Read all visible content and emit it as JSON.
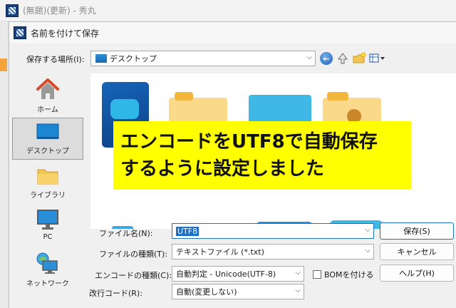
{
  "parent_window": {
    "title": "(無題)(更新) - 秀丸"
  },
  "dialog": {
    "title": "名前を付けて保存",
    "location": {
      "label": "保存する場所(I):",
      "value": "デスクトップ"
    },
    "toolbar": {
      "back_icon": "back-arrow-icon",
      "up_icon": "up-folder-icon",
      "new_folder_icon": "new-folder-icon",
      "view_icon": "view-menu-icon"
    },
    "sidebar": [
      {
        "label": "ホーム",
        "icon": "home-icon",
        "selected": false
      },
      {
        "label": "デスクトップ",
        "icon": "desktop-icon",
        "selected": true
      },
      {
        "label": "ライブラリ",
        "icon": "library-folder-icon",
        "selected": false
      },
      {
        "label": "PC",
        "icon": "pc-monitor-icon",
        "selected": false
      },
      {
        "label": "ネットワーク",
        "icon": "network-icon",
        "selected": false
      }
    ],
    "banner": {
      "line1": "エンコードをUTF8で自動保存",
      "line2": "するように設定しました",
      "color": "#ffff00"
    },
    "form": {
      "filename": {
        "label": "ファイル名(N):",
        "value": "UTF8"
      },
      "filetype": {
        "label": "ファイルの種類(T):",
        "value": "テキストファイル (*.txt)"
      },
      "encoding": {
        "label": "エンコードの種類(C):",
        "value": "自動判定 - Unicode(UTF-8)"
      },
      "bom": {
        "label": "BOMを付ける",
        "checked": false
      },
      "linebreak": {
        "label": "改行コード(R):",
        "value": "自動(変更しない)"
      }
    },
    "buttons": {
      "save": "保存(S)",
      "cancel": "キャンセル",
      "help": "ヘルプ(H)"
    }
  }
}
